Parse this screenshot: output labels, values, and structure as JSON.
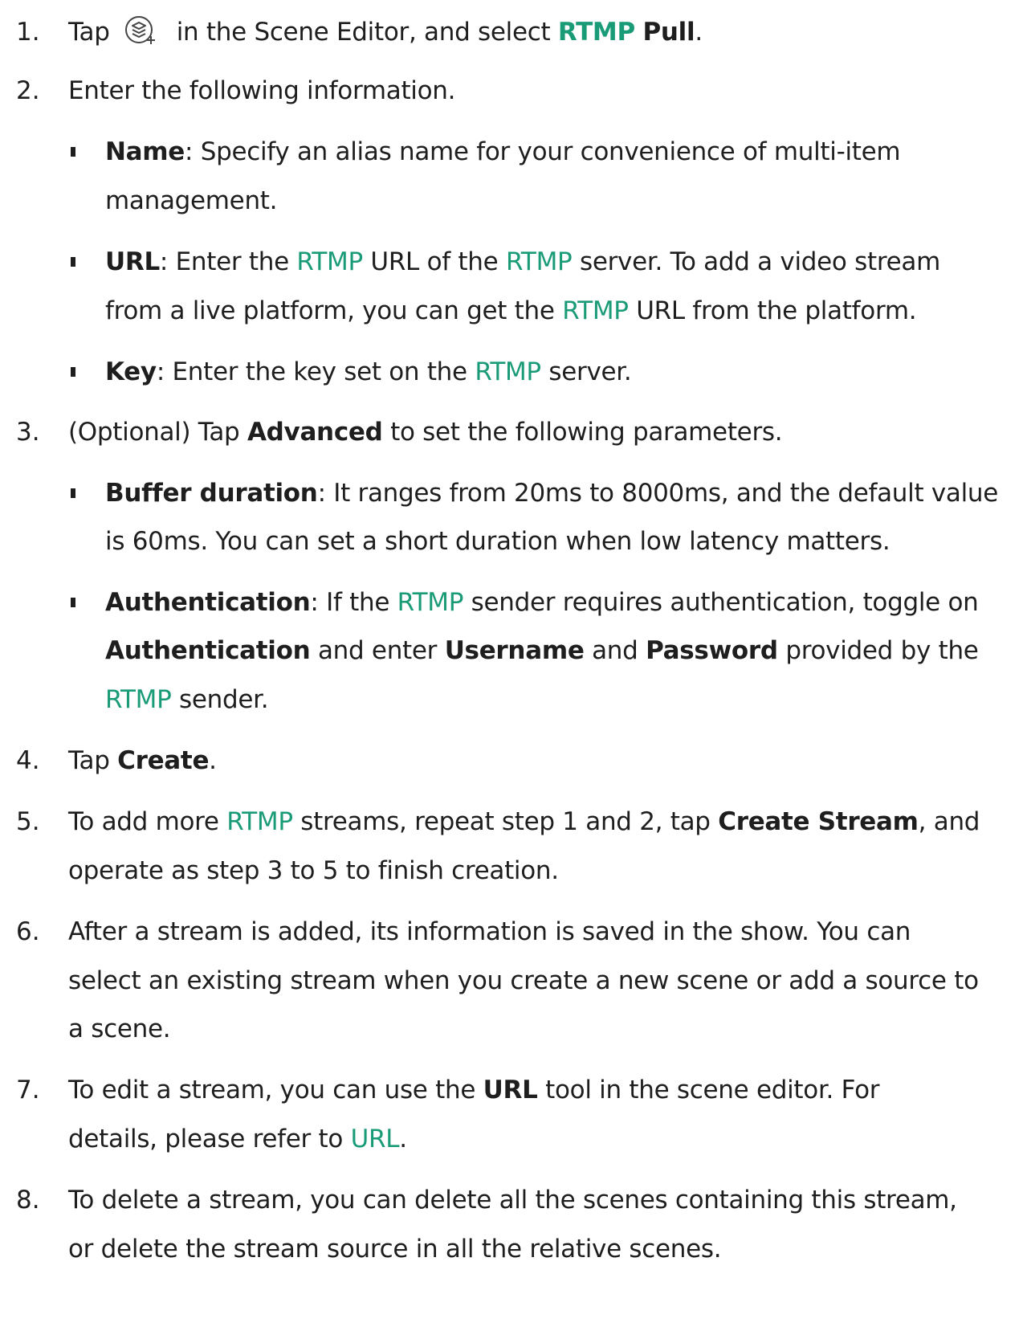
{
  "accent_color": "#1a9b78",
  "steps": [
    {
      "num": "1.",
      "lines": [
        [
          "Tap ",
          "ICON",
          " in the Scene Editor, and select ",
          "RTMP",
          " ",
          "Pull",
          "."
        ]
      ]
    },
    {
      "num": "2.",
      "lines": [
        [
          "Enter the following information."
        ]
      ]
    },
    {
      "num": "3.",
      "lines": [
        [
          "(Optional) Tap ",
          "Advanced",
          " to set the following parameters."
        ]
      ]
    },
    {
      "num": "4.",
      "lines": [
        [
          "Tap ",
          "Create",
          "."
        ]
      ]
    },
    {
      "num": "5.",
      "lines": [
        [
          "To add more ",
          "RTMP",
          " streams, repeat step 1 and 2, tap ",
          "Create Stream",
          ", and"
        ],
        [
          "operate as step 3 to 5 to finish creation."
        ]
      ]
    },
    {
      "num": "6.",
      "lines": [
        [
          "After a stream is added, its information is saved in the show. You can"
        ],
        [
          "select an existing stream when you create a new scene or add a source to"
        ],
        [
          "a scene."
        ]
      ]
    },
    {
      "num": "7.",
      "lines": [
        [
          "To edit a stream, you can use the ",
          "URL",
          " tool in the scene editor. For"
        ],
        [
          "details, please refer to ",
          "URL",
          "."
        ]
      ]
    },
    {
      "num": "8.",
      "lines": [
        [
          "To delete a stream, you can delete all the scenes containing this stream,"
        ],
        [
          "or delete the stream source in all the relative scenes."
        ]
      ]
    }
  ],
  "sub_items": [
    {
      "lines": [
        [
          "Name",
          ": Specify an alias name for your convenience of multi-item"
        ],
        [
          "management."
        ]
      ]
    },
    {
      "lines": [
        [
          "URL",
          ": Enter the ",
          "RTMP",
          " URL of the ",
          "RTMP",
          " server. To add a video stream"
        ],
        [
          "from a live platform, you can get the ",
          "RTMP",
          " URL from the platform."
        ]
      ]
    },
    {
      "lines": [
        [
          "Key",
          ": Enter the key set on the ",
          "RTMP",
          " server."
        ]
      ]
    },
    {
      "lines": [
        [
          "Buffer duration",
          ": It ranges from 20ms to 8000ms, and the default value"
        ],
        [
          "is 60ms. You can set a short duration when low latency matters."
        ]
      ]
    },
    {
      "lines": [
        [
          "Authentication",
          ": If the ",
          "RTMP",
          " sender requires authentication, toggle on"
        ],
        [
          "Authentication",
          " and enter ",
          "Username",
          " and ",
          "Password",
          " provided by the"
        ],
        [
          "RTMP",
          " sender."
        ]
      ]
    }
  ],
  "icons": {
    "add_source": "layers-add-icon"
  }
}
